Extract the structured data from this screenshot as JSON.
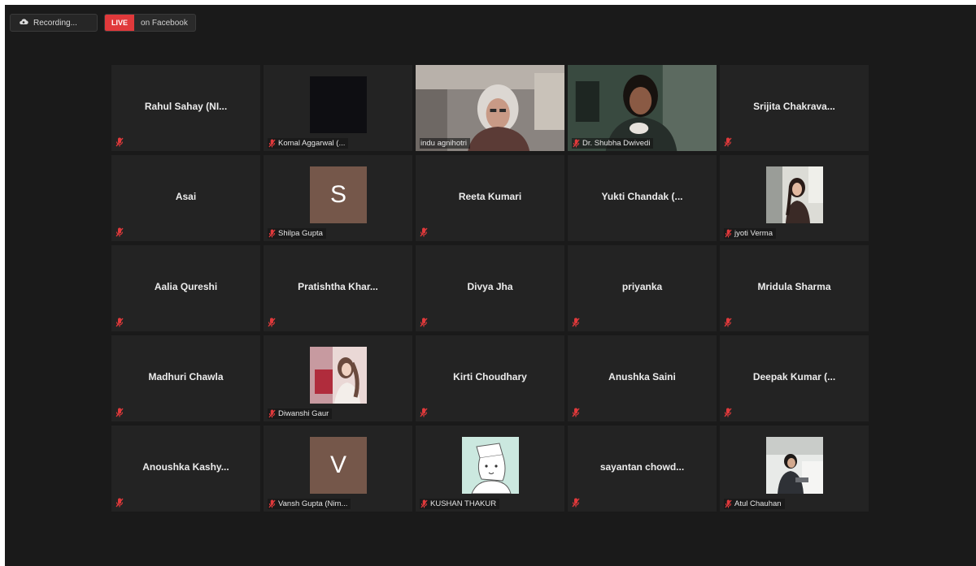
{
  "topbar": {
    "recording_label": "Recording...",
    "live_badge": "LIVE",
    "live_platform": "on Facebook"
  },
  "participants": [
    {
      "name": "Rahul Sahay (NI...",
      "kind": "name",
      "muted": true
    },
    {
      "name": "Komal Aggarwal (...",
      "kind": "black",
      "muted": true
    },
    {
      "name": "indu agnihotri",
      "kind": "video-woman-grey",
      "muted": false,
      "active": true
    },
    {
      "name": "Dr. Shubha Dwivedi",
      "kind": "video-woman-dark",
      "muted": true
    },
    {
      "name": "Srijita Chakrava...",
      "kind": "name",
      "muted": true
    },
    {
      "name": "Asai",
      "kind": "name",
      "muted": true
    },
    {
      "name": "Shilpa Gupta",
      "kind": "letter",
      "letter": "S",
      "muted": true
    },
    {
      "name": "Reeta Kumari",
      "kind": "name",
      "muted": true
    },
    {
      "name": "Yukti Chandak (...",
      "kind": "name",
      "muted": false
    },
    {
      "name": "jyoti Verma",
      "kind": "photo-girl",
      "muted": true
    },
    {
      "name": "Aalia Qureshi",
      "kind": "name",
      "muted": true
    },
    {
      "name": "Pratishtha Khar...",
      "kind": "name",
      "muted": true
    },
    {
      "name": "Divya Jha",
      "kind": "name",
      "muted": true
    },
    {
      "name": "priyanka",
      "kind": "name",
      "muted": true
    },
    {
      "name": "Mridula Sharma",
      "kind": "name",
      "muted": true
    },
    {
      "name": "Madhuri Chawla",
      "kind": "name",
      "muted": true
    },
    {
      "name": "Diwanshi Gaur",
      "kind": "photo-pink",
      "muted": true
    },
    {
      "name": "Kirti Choudhary",
      "kind": "name",
      "muted": true
    },
    {
      "name": "Anushka Saini",
      "kind": "name",
      "muted": true
    },
    {
      "name": "Deepak Kumar (...",
      "kind": "name",
      "muted": true
    },
    {
      "name": "Anoushka Kashy...",
      "kind": "name",
      "muted": true
    },
    {
      "name": "Vansh Gupta (Nim...",
      "kind": "letter",
      "letter": "V",
      "muted": true
    },
    {
      "name": "KUSHAN THAKUR",
      "kind": "photo-sketch",
      "muted": true
    },
    {
      "name": "sayantan chowd...",
      "kind": "name",
      "muted": true
    },
    {
      "name": "Atul Chauhan",
      "kind": "photo-boy",
      "muted": true
    }
  ],
  "colors": {
    "background": "#1a1a1a",
    "tile": "#232323",
    "active_border": "#b7d867",
    "muted_icon": "#e0393b",
    "live_badge": "#e0393b",
    "letter_avatar": "#75574a"
  },
  "icons": {
    "muted": "mic-muted-icon",
    "recording": "cloud-recording-icon"
  }
}
